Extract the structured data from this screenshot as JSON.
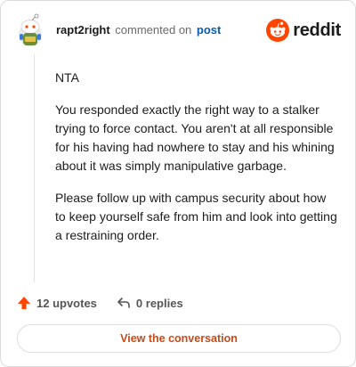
{
  "header": {
    "author": "rapt2right",
    "verb": "commented on",
    "link": "post",
    "brand": "reddit"
  },
  "comment": {
    "paragraphs": [
      "NTA",
      "You responded exactly the right way to a stalker trying to force contact. You aren't at all responsible for his having had nowhere to stay and his whining about it was simply manipulative garbage.",
      "Please follow up with campus security about how to keep yourself safe from him and look into getting a restraining order."
    ]
  },
  "actions": {
    "upvotes": "12 upvotes",
    "replies": "0 replies"
  },
  "cta": "View the conversation",
  "colors": {
    "accent": "#ff4500",
    "link": "#0b5cad",
    "cta_text": "#c74a17"
  },
  "icons": {
    "avatar": "snoo-avatar",
    "brand": "reddit-logo-icon",
    "upvote": "upvote-arrow-icon",
    "reply": "reply-arrow-icon"
  }
}
